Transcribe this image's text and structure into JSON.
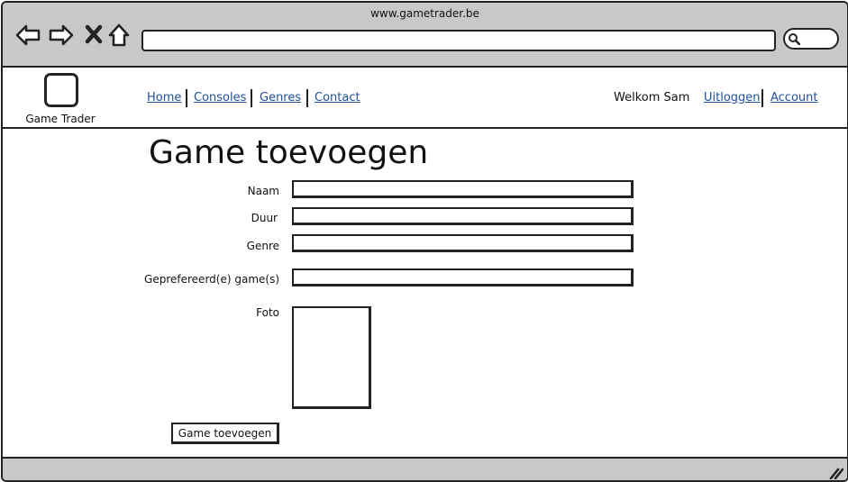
{
  "browser": {
    "url": "www.gametrader.be",
    "address_value": "",
    "icons": [
      "back-arrow-icon",
      "forward-arrow-icon",
      "close-icon",
      "home-icon",
      "search-icon",
      "resize-grip-icon"
    ]
  },
  "header": {
    "logo_text": "Game Trader",
    "nav": [
      {
        "label": "Home"
      },
      {
        "label": "Consoles"
      },
      {
        "label": "Genres"
      },
      {
        "label": "Contact"
      }
    ],
    "welcome": "Welkom Sam",
    "logout": "Uitloggen",
    "account": "Account",
    "link_color": "#1f4f99"
  },
  "form": {
    "title": "Game toevoegen",
    "fields": [
      {
        "label": "Naam",
        "value": ""
      },
      {
        "label": "Duur",
        "value": ""
      },
      {
        "label": "Genre",
        "value": ""
      },
      {
        "label": "Geprefereerd(e) game(s)",
        "value": ""
      }
    ],
    "photo_label": "Foto",
    "submit_label": "Game toevoegen"
  }
}
